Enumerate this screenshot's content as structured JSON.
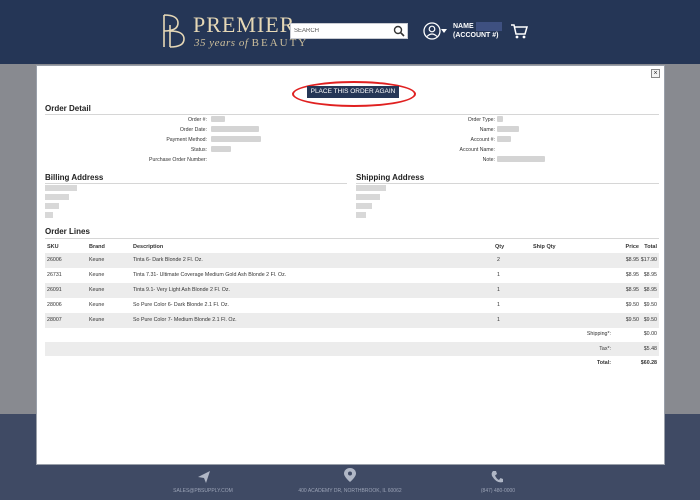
{
  "header": {
    "brand_title": "PREMIER",
    "brand_subtitle_italic": "35 years of",
    "brand_subtitle_caps": "BEAUTY",
    "search_placeholder": "SEARCH",
    "account_name": "NAME",
    "account_id": "(ACCOUNT #)"
  },
  "modal": {
    "close_label": "×",
    "reorder_label": "PLACE THIS ORDER AGAIN",
    "order_detail": {
      "title": "Order Detail",
      "left_labels": [
        "Order #:",
        "Order Date:",
        "Payment Method:",
        "Status:",
        "Purchase Order Number:"
      ],
      "right_labels": [
        "Order Type:",
        "Name:",
        "Account #:",
        "Account Name:",
        "Note:"
      ]
    },
    "billing": {
      "title": "Billing Address"
    },
    "shipping": {
      "title": "Shipping Address"
    },
    "order_lines": {
      "title": "Order Lines",
      "columns": [
        "SKU",
        "Brand",
        "Description",
        "Qty",
        "Ship Qty",
        "Price",
        "Total"
      ],
      "rows": [
        {
          "sku": "26006",
          "brand": "Keune",
          "description": "Tinta 6- Dark Blonde 2 Fl. Oz.",
          "qty": "2",
          "ship_qty": "",
          "price": "$8.95",
          "total": "$17.90"
        },
        {
          "sku": "26731",
          "brand": "Keune",
          "description": "Tinta 7.31- Ultimate Coverage Medium Gold Ash Blonde 2 Fl. Oz.",
          "qty": "1",
          "ship_qty": "",
          "price": "$8.95",
          "total": "$8.95"
        },
        {
          "sku": "26091",
          "brand": "Keune",
          "description": "Tinta 9.1- Very Light Ash Blonde 2 Fl. Oz.",
          "qty": "1",
          "ship_qty": "",
          "price": "$8.95",
          "total": "$8.95"
        },
        {
          "sku": "28006",
          "brand": "Keune",
          "description": "So Pure Color 6- Dark Blonde 2.1 Fl. Oz.",
          "qty": "1",
          "ship_qty": "",
          "price": "$9.50",
          "total": "$9.50"
        },
        {
          "sku": "28007",
          "brand": "Keune",
          "description": "So Pure Color 7- Medium Blonde 2.1 Fl. Oz.",
          "qty": "1",
          "ship_qty": "",
          "price": "$9.50",
          "total": "$9.50"
        }
      ],
      "shipping_label": "Shipping*:",
      "shipping_value": "$0.00",
      "tax_label": "Tax*:",
      "tax_value": "$5.48",
      "total_label": "Total:",
      "total_value": "$60.28"
    }
  },
  "footer": {
    "email": "SALES@PBSUPPLY.COM",
    "address": "400 ACADEMY DR, NORTHBROOK, IL 60062",
    "phone": "(847) 480-0000"
  },
  "colors": {
    "navy": "#253656",
    "gold": "#e6d8b6",
    "highlight_red": "#e02020"
  }
}
